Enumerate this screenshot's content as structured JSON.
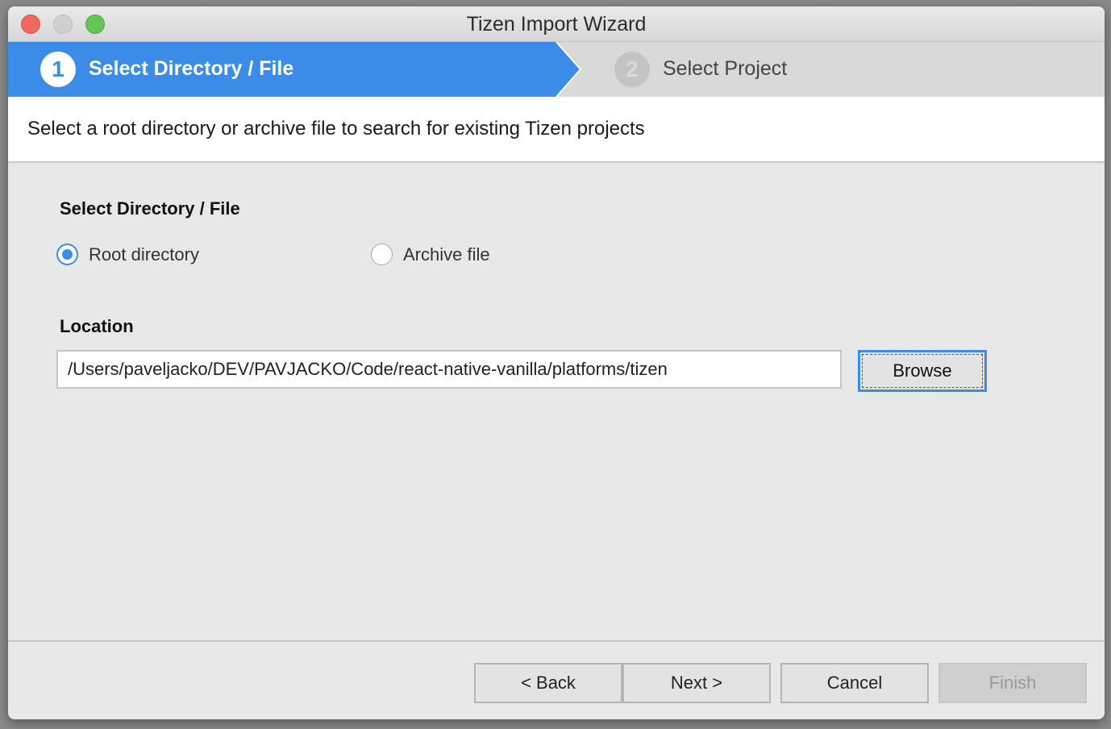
{
  "window": {
    "title": "Tizen Import Wizard"
  },
  "steps": [
    {
      "number": "1",
      "label": "Select Directory / File"
    },
    {
      "number": "2",
      "label": "Select Project"
    }
  ],
  "description": "Select a root directory or archive file to search for existing Tizen projects",
  "section_title": "Select Directory / File",
  "radios": [
    {
      "label": "Root directory",
      "selected": true
    },
    {
      "label": "Archive file",
      "selected": false
    }
  ],
  "location": {
    "label": "Location",
    "value": "/Users/paveljacko/DEV/PAVJACKO/Code/react-native-vanilla/platforms/tizen"
  },
  "browse_label": "Browse",
  "buttons": {
    "back": "< Back",
    "next": "Next >",
    "cancel": "Cancel",
    "finish": "Finish"
  },
  "colors": {
    "accent": "#3a8ce6"
  }
}
